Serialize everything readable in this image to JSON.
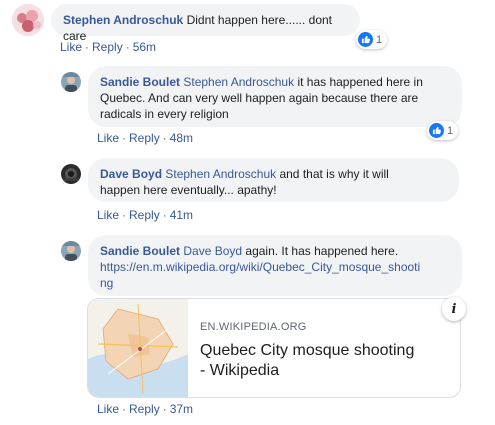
{
  "comments": [
    {
      "author": "Stephen Androschuk",
      "text": "Didnt happen here...... dont care",
      "actions": {
        "like": "Like",
        "reply": "Reply",
        "time": "56m"
      },
      "reactions": {
        "icon": "like-icon",
        "count": "1"
      }
    },
    {
      "author": "Sandie Boulet",
      "mention": "Stephen Androschuk",
      "text_line1": " it has happened here in",
      "text_line2": "Quebec. And can very well happen again because there are",
      "text_line3": "radicals in every religion",
      "actions": {
        "like": "Like",
        "reply": "Reply",
        "time": "48m"
      },
      "reactions": {
        "icon": "like-icon",
        "count": "1"
      }
    },
    {
      "author": "Dave Boyd",
      "mention": "Stephen Androschuk",
      "text_line1": " and that is why it will",
      "text_line2": "happen here eventually... apathy!",
      "actions": {
        "like": "Like",
        "reply": "Reply",
        "time": "41m"
      }
    },
    {
      "author": "Sandie Boulet",
      "mention": "Dave Boyd",
      "text_line1": " again. It has happened here.",
      "link_line1": "https://en.m.wikipedia.org/wiki/Quebec_City_mosque_shooti",
      "link_line2": "ng",
      "actions": {
        "like": "Like",
        "reply": "Reply",
        "time": "37m"
      },
      "preview": {
        "domain": "EN.WIKIPEDIA.ORG",
        "title": "Quebec City mosque shooting - Wikipedia",
        "thumb_label": "map-thumbnail"
      }
    }
  ],
  "colors": {
    "link": "#385898",
    "bubble": "#f2f3f5",
    "like_blue": "#1877f2",
    "meta": "#606770"
  }
}
